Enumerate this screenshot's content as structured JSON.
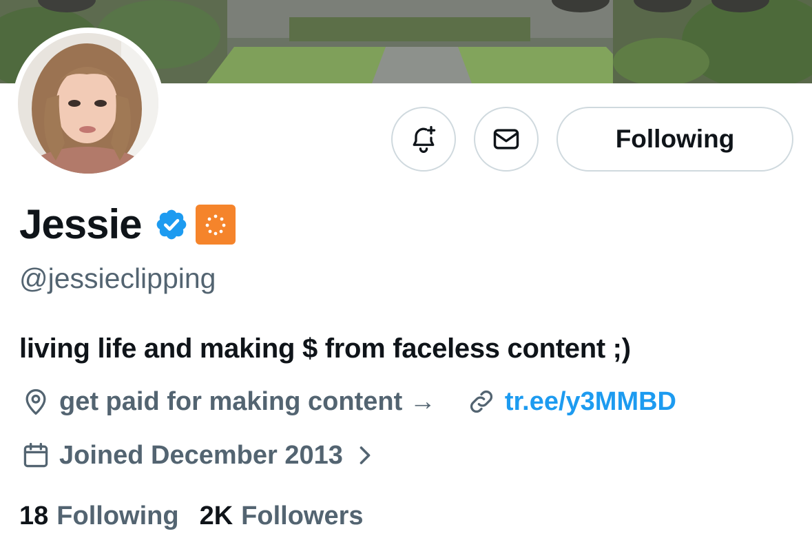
{
  "profile": {
    "name": "Jessie",
    "handle": "@jessieclipping",
    "bio": "living life and making $ from faceless content ;)",
    "location": "get paid for making content →",
    "website": "tr.ee/y3MMBD",
    "joined": "Joined December 2013"
  },
  "actions": {
    "follow_label": "Following"
  },
  "stats": [
    {
      "value": "18",
      "label": "Following"
    },
    {
      "value": "2K",
      "label": "Followers"
    }
  ],
  "icons": {
    "notify": "bell-plus-icon",
    "message": "envelope-icon",
    "verified": "verified-badge-icon",
    "affiliate": "affiliate-badge-icon",
    "location": "location-pin-icon",
    "link": "link-icon",
    "calendar": "calendar-icon",
    "chevron": "chevron-right-icon"
  },
  "colors": {
    "text_primary": "#0f1419",
    "text_secondary": "#536471",
    "link": "#1d9bf0",
    "verified": "#1d9bf0",
    "affiliate_badge": "#f5842b",
    "border": "#cfd9de"
  }
}
